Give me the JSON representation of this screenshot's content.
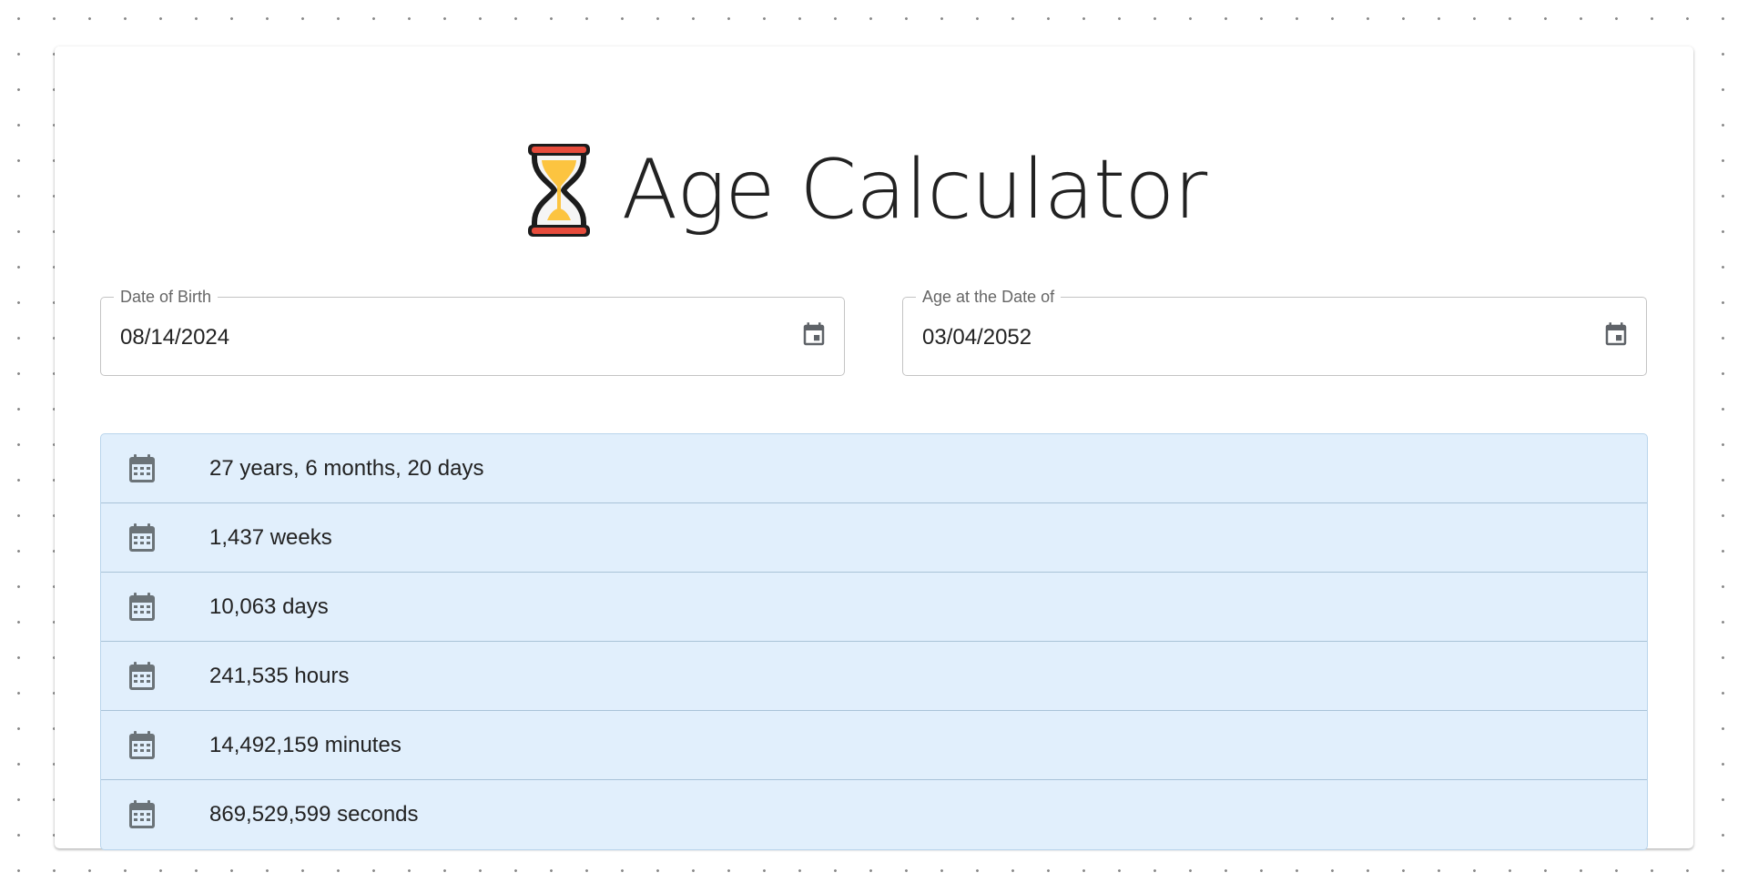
{
  "app": {
    "title": "Age Calculator",
    "title_icon": "hourglass-icon"
  },
  "inputs": {
    "date_of_birth": {
      "label": "Date of Birth",
      "value": "08/14/2024",
      "icon": "calendar-icon"
    },
    "age_at_date": {
      "label": "Age at the Date of",
      "value": "03/04/2052",
      "icon": "calendar-icon"
    }
  },
  "results": [
    {
      "icon": "calendar-month-icon",
      "text": "27 years, 6 months, 20 days"
    },
    {
      "icon": "calendar-month-icon",
      "text": "1,437 weeks"
    },
    {
      "icon": "calendar-month-icon",
      "text": "10,063 days"
    },
    {
      "icon": "calendar-month-icon",
      "text": "241,535 hours"
    },
    {
      "icon": "calendar-month-icon",
      "text": "14,492,159 minutes"
    },
    {
      "icon": "calendar-month-icon",
      "text": "869,529,599 seconds"
    }
  ],
  "colors": {
    "results_background": "#e1effc",
    "results_divider": "#a9c3d8",
    "hourglass_frame": "#e74c3c",
    "hourglass_sand": "#fcc440",
    "icon_gray": "#6b7378"
  }
}
